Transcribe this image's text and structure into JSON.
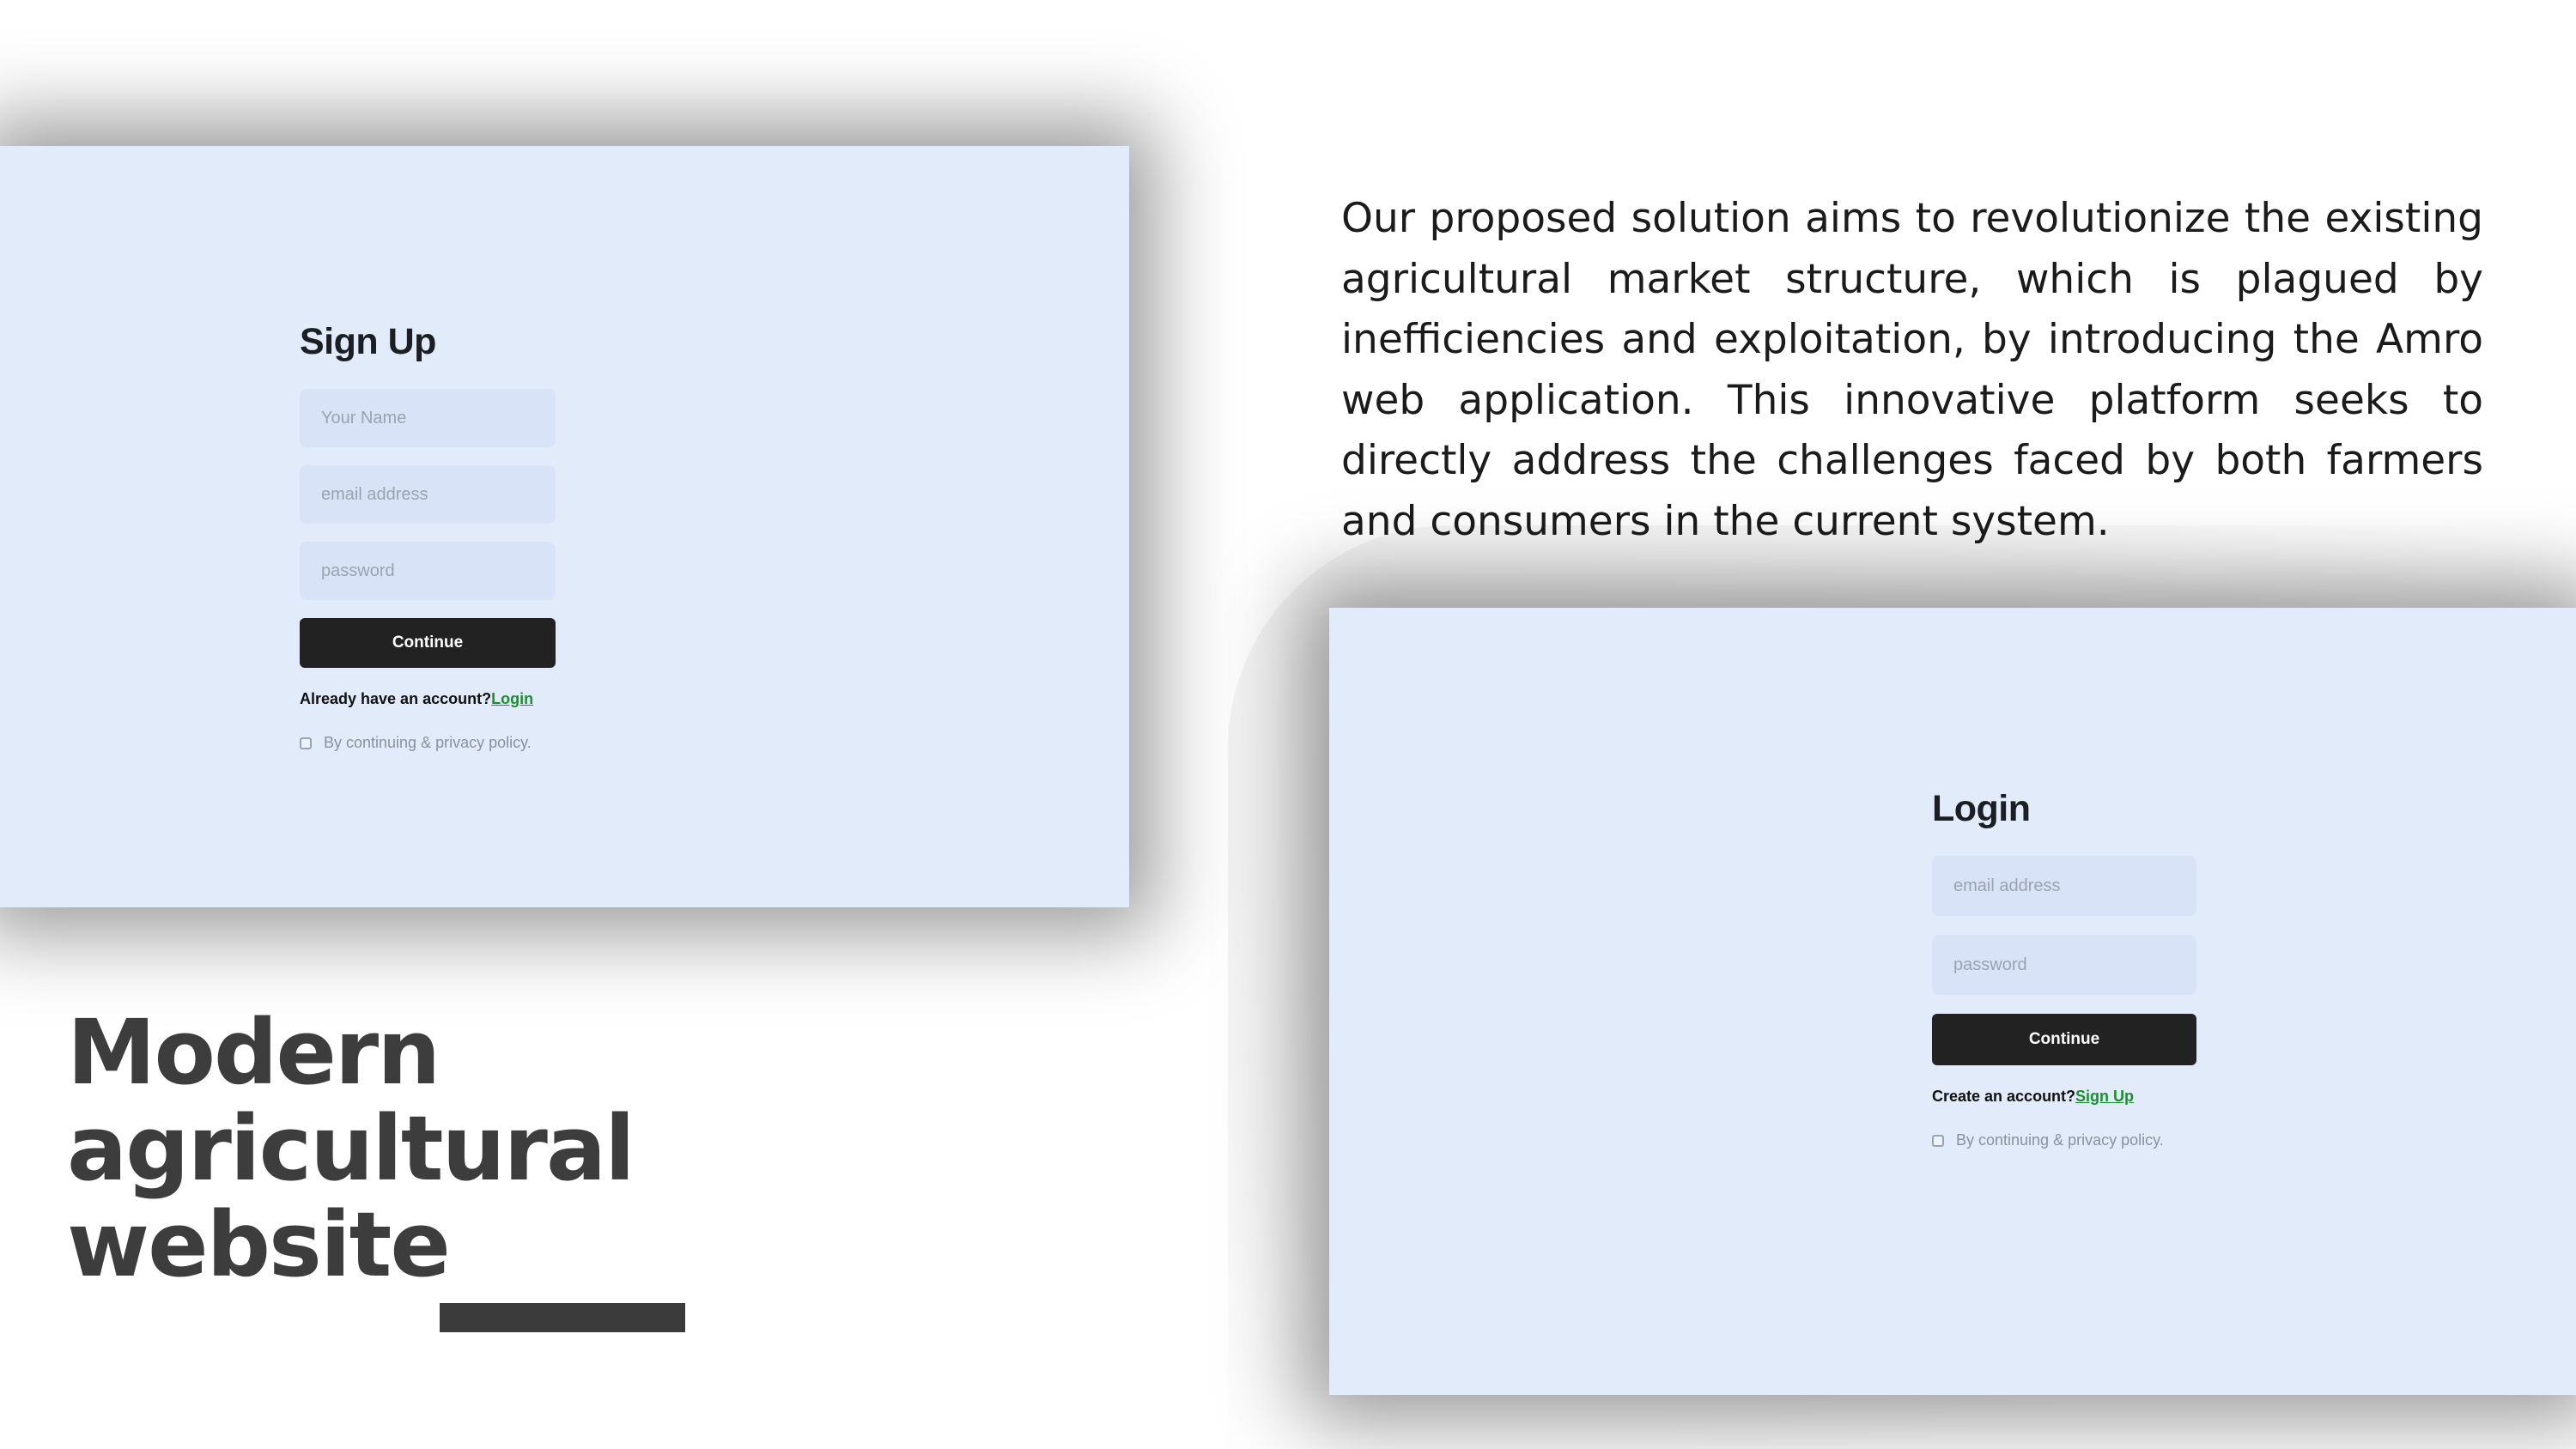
{
  "signup": {
    "title": "Sign Up",
    "name_placeholder": "Your Name",
    "email_placeholder": "email address",
    "password_placeholder": "password",
    "continue_label": "Continue",
    "account_prompt": "Already have an account?",
    "login_link": "Login",
    "policy_text": "By continuing & privacy policy."
  },
  "login": {
    "title": "Login",
    "email_placeholder": "email address",
    "password_placeholder": "password",
    "continue_label": "Continue",
    "account_prompt": "Create an account?",
    "signup_link": "Sign Up",
    "policy_text": "By continuing & privacy policy."
  },
  "description": "Our proposed solution aims to revolutionize the existing agricultural market structure, which is plagued by inefficiencies and exploitation, by introducing the Amro web application. This innovative platform seeks to directly address the challenges faced by both farmers and consumers in the current system.",
  "headline": {
    "line1": "Modern",
    "line2": "agricultural",
    "line3": "website"
  },
  "colors": {
    "panel_background": "#e1ebfa",
    "button_dark": "#222222",
    "link_green": "#1a8f2e",
    "headline_gray": "#3d3d3d"
  }
}
